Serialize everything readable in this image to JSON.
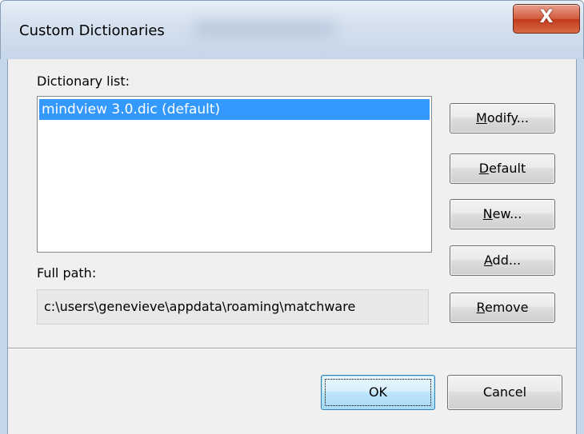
{
  "window": {
    "title": "Custom Dictionaries",
    "close_glyph": "X"
  },
  "dictionary_list": {
    "label": "Dictionary list:",
    "items": [
      {
        "text": "mindview 3.0.dic (default)",
        "selected": true
      }
    ]
  },
  "full_path": {
    "label": "Full path:",
    "value": "c:\\users\\genevieve\\appdata\\roaming\\matchware"
  },
  "buttons": {
    "modify": {
      "pre": "",
      "accel": "M",
      "post": "odify..."
    },
    "default": {
      "pre": "",
      "accel": "D",
      "post": "efault"
    },
    "new": {
      "pre": "",
      "accel": "N",
      "post": "ew..."
    },
    "add": {
      "pre": "",
      "accel": "A",
      "post": "dd..."
    },
    "remove": {
      "pre": "",
      "accel": "R",
      "post": "emove"
    },
    "ok": "OK",
    "cancel": "Cancel"
  },
  "colors": {
    "selection": "#3399ff",
    "dialog_background": "#f0f0f0",
    "close_button": "#c03a1c"
  }
}
